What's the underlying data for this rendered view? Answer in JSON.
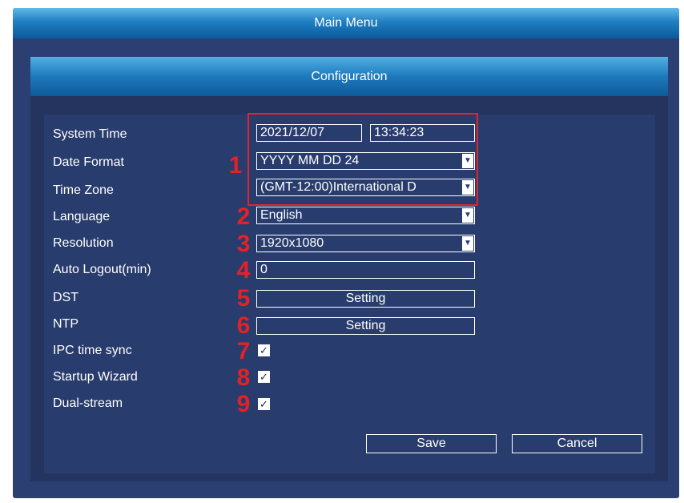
{
  "window": {
    "title": "Main Menu"
  },
  "panel": {
    "title": "Configuration"
  },
  "labels": {
    "system_time": "System Time",
    "date_format": "Date Format",
    "time_zone": "Time Zone",
    "language": "Language",
    "resolution": "Resolution",
    "auto_logout": "Auto Logout(min)",
    "dst": "DST",
    "ntp": "NTP",
    "ipc_time_sync": "IPC time sync",
    "startup_wizard": "Startup Wizard",
    "dual_stream": "Dual-stream"
  },
  "values": {
    "date": "2021/12/07",
    "time": "13:34:23",
    "date_format": "YYYY MM DD 24",
    "time_zone": "(GMT-12:00)International D",
    "language": "English",
    "resolution": "1920x1080",
    "auto_logout": "0",
    "dst_button": "Setting",
    "ntp_button": "Setting",
    "ipc_time_sync_checked": true,
    "startup_wizard_checked": true,
    "dual_stream_checked": true
  },
  "markers": [
    "1",
    "2",
    "3",
    "4",
    "5",
    "6",
    "7",
    "8",
    "9"
  ],
  "buttons": {
    "save": "Save",
    "cancel": "Cancel"
  },
  "glyphs": {
    "dropdown": "▼",
    "check": "✓"
  },
  "colors": {
    "background": "#2c3f73",
    "title_bar": "#1f7fc3",
    "annotation_red": "#e32126"
  }
}
